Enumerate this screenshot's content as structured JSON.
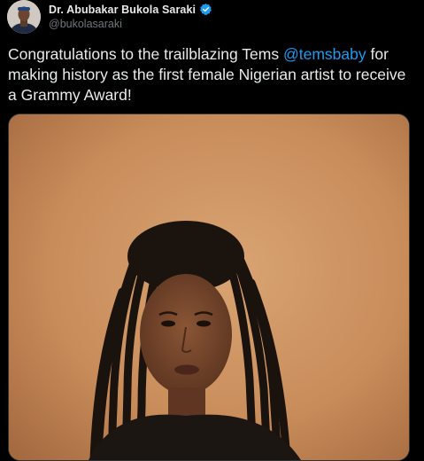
{
  "author": {
    "display_name": "Dr. Abubakar Bukola Saraki",
    "handle": "@bukolasaraki",
    "verified": true,
    "avatar_icon": "user-avatar"
  },
  "tweet": {
    "text_before": "Congratulations to the trailblazing Tems ",
    "mention": "@temsbaby",
    "text_after": " for making history as the first female Nigerian artist to receive a Grammy Award!"
  },
  "media": {
    "type": "photo",
    "icon": "portrait-photo"
  },
  "colors": {
    "background": "#000000",
    "text": "#e7e9ea",
    "secondary_text": "#71767b",
    "mention": "#1d9bf0",
    "verified_badge": "#1d9bf0",
    "photo_backdrop": "#c78e5d"
  }
}
